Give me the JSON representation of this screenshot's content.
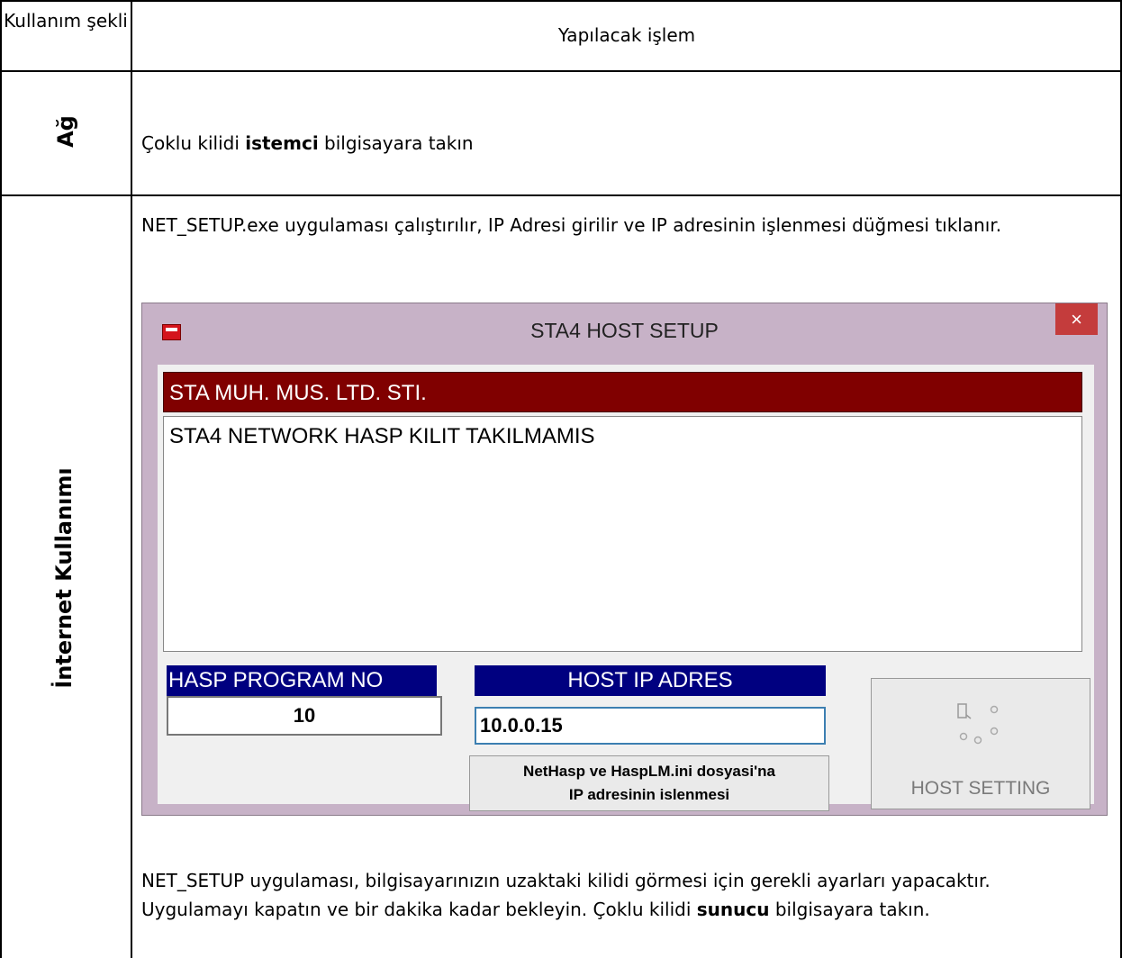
{
  "table": {
    "header_col1": "Kullanım şekli",
    "header_col2": "Yapılacak işlem",
    "row1_label": "Ağ",
    "row1_text_before": "Çoklu kilidi ",
    "row1_text_bold": "istemci",
    "row1_text_after": " bilgisayara takın",
    "row2_label": "İnternet Kullanımı",
    "row2_intro": "NET_SETUP.exe uygulaması çalıştırılır, IP Adresi girilir ve IP adresinin işlenmesi düğmesi tıklanır.",
    "row2_outro_before": "NET_SETUP uygulaması, bilgisayarınızın uzaktaki kilidi görmesi için gerekli ayarları yapacaktır. Uygulamayı kapatın ve bir dakika kadar bekleyin. Çoklu kilidi ",
    "row2_outro_bold": "sunucu",
    "row2_outro_after": " bilgisayara takın."
  },
  "dialog": {
    "title": "STA4 HOST SETUP",
    "close_glyph": "×",
    "company": "STA MUH. MUS. LTD. STI.",
    "status": "STA4 NETWORK HASP KILIT TAKILMAMIS",
    "hasp_label": "HASP PROGRAM NO",
    "hasp_value": "10",
    "host_ip_label": "HOST IP ADRES",
    "host_ip_value": "10.0.0.15",
    "ip_button_line1": "NetHasp  ve HaspLM.ini dosyasi'na",
    "ip_button_line2": "IP adresinin islenmesi",
    "host_button_label": "HOST SETTING",
    "host_button_icon": "network-icon"
  },
  "colors": {
    "dialog_bg": "#c7b2c7",
    "company_bg": "#800000",
    "label_bg": "#000080",
    "close_bg": "#c43c3c"
  }
}
